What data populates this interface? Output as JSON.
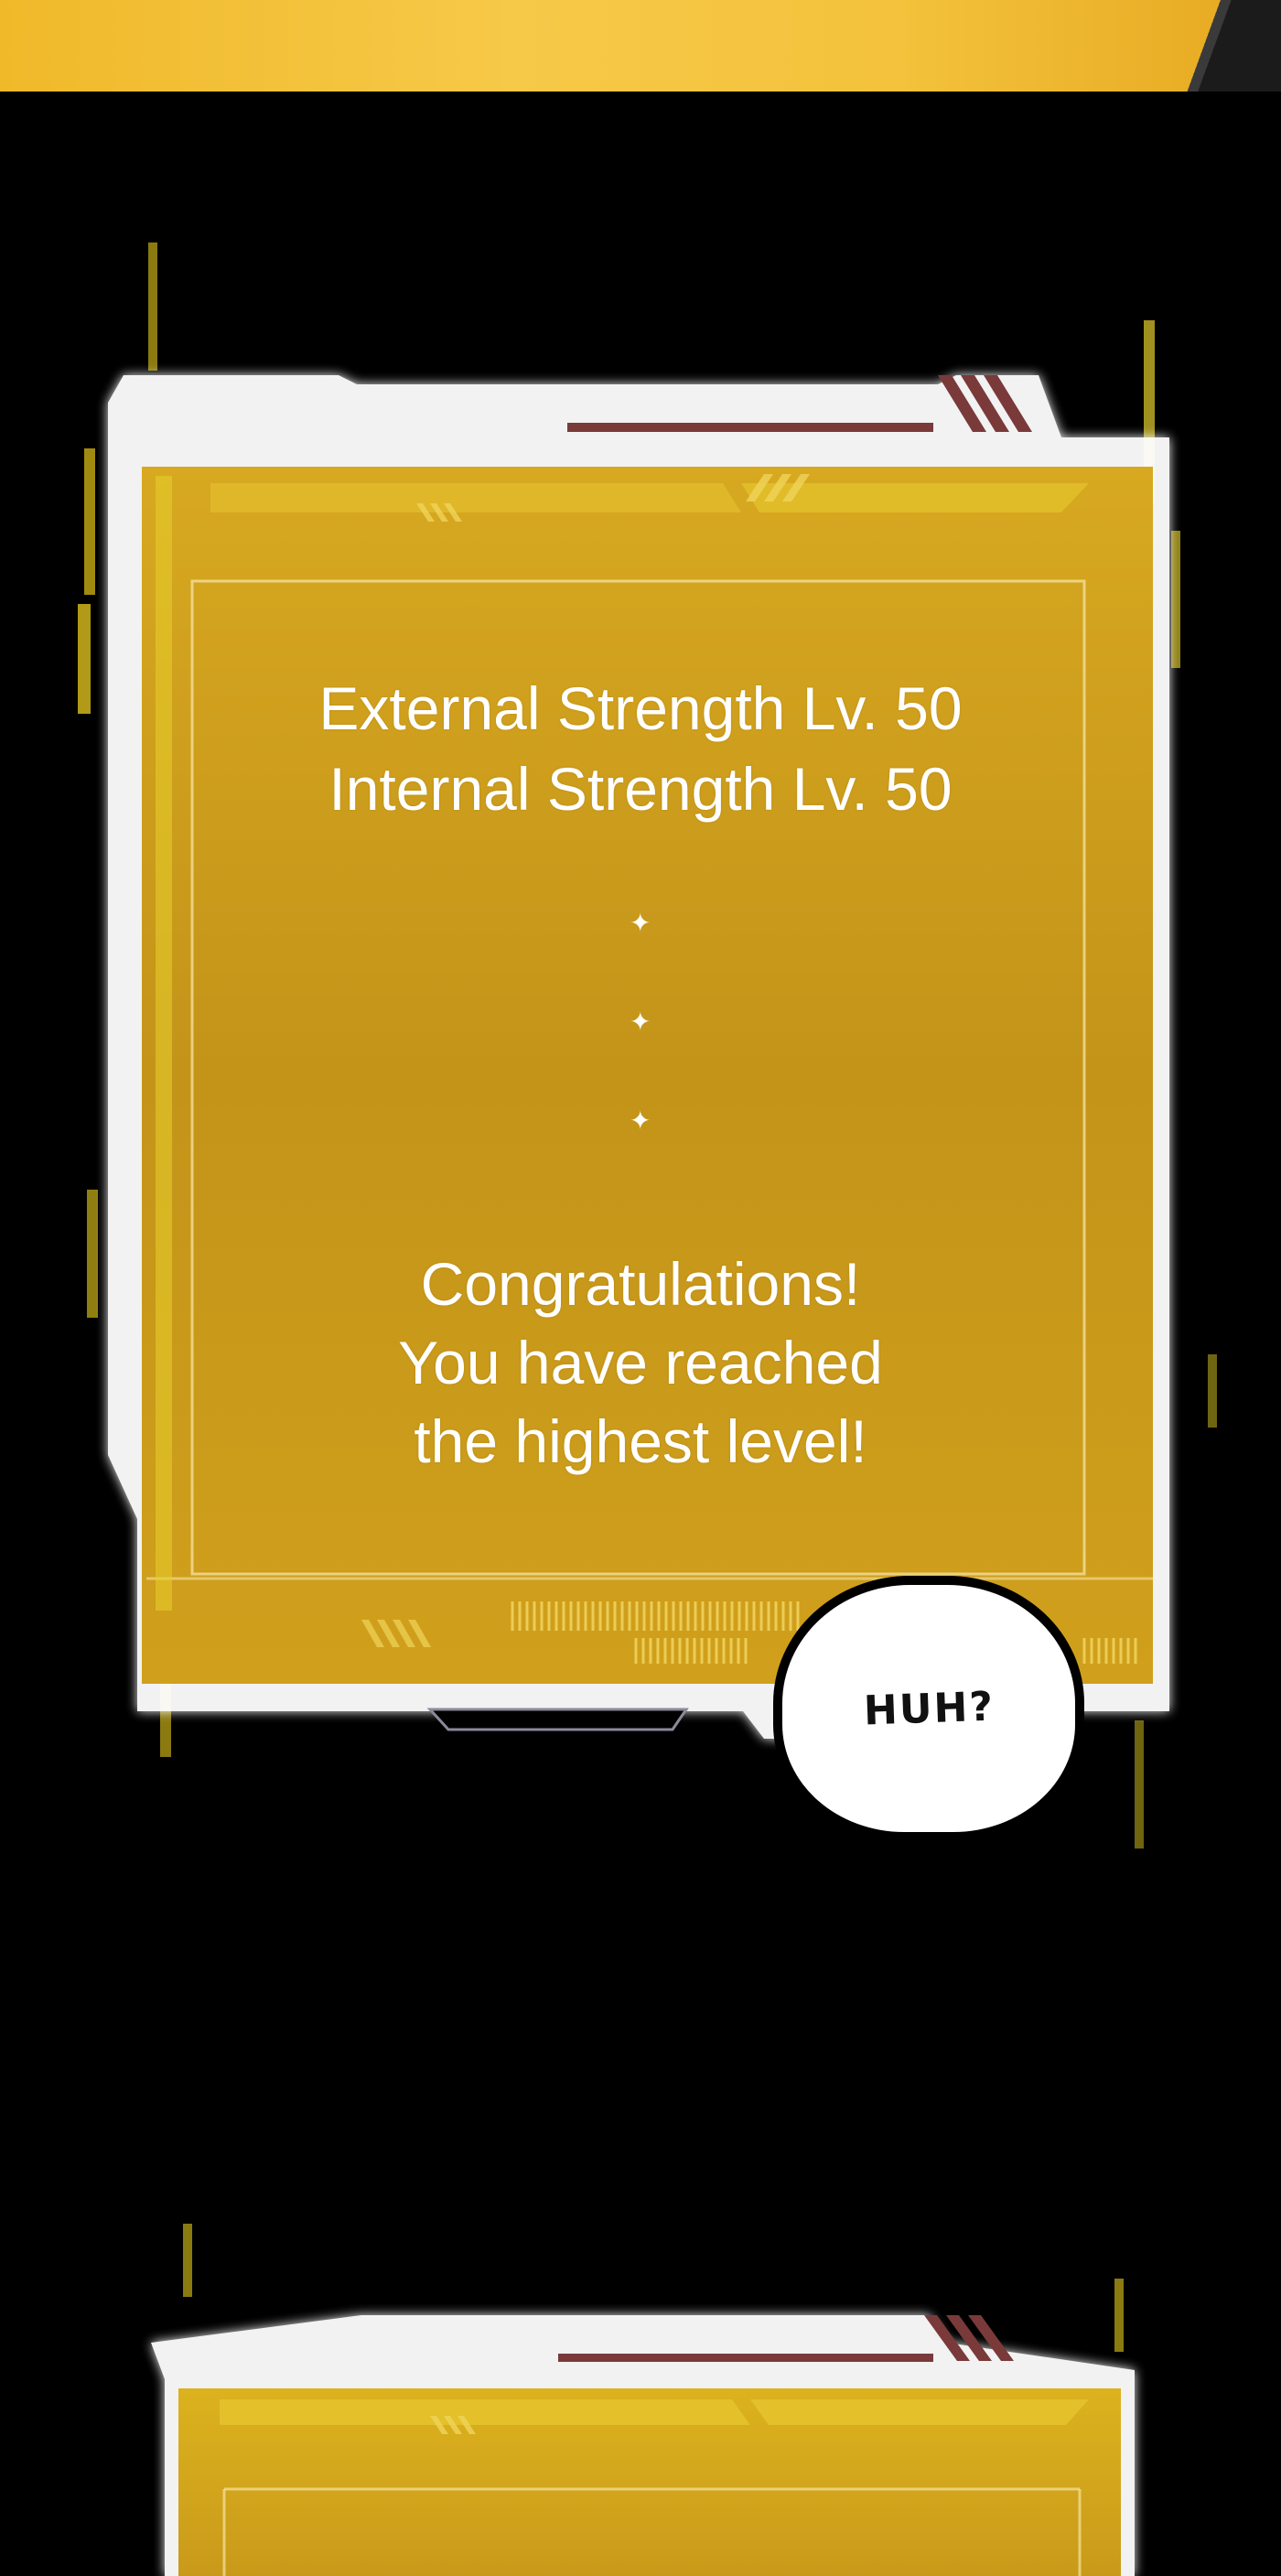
{
  "panel": {
    "stats": [
      "External Strength Lv. 50",
      "Internal Strength Lv. 50"
    ],
    "separator_glyph": "✦",
    "congrats": [
      "Congratulations!",
      "You have reached",
      "the highest level!"
    ]
  },
  "speech_bubble": {
    "text": "HUH?"
  },
  "colors": {
    "panel_gold": "#c8981c",
    "panel_highlight": "#e8c030",
    "frame_white": "#ffffff",
    "frame_maroon": "#7a3a3a",
    "background": "#000000"
  }
}
